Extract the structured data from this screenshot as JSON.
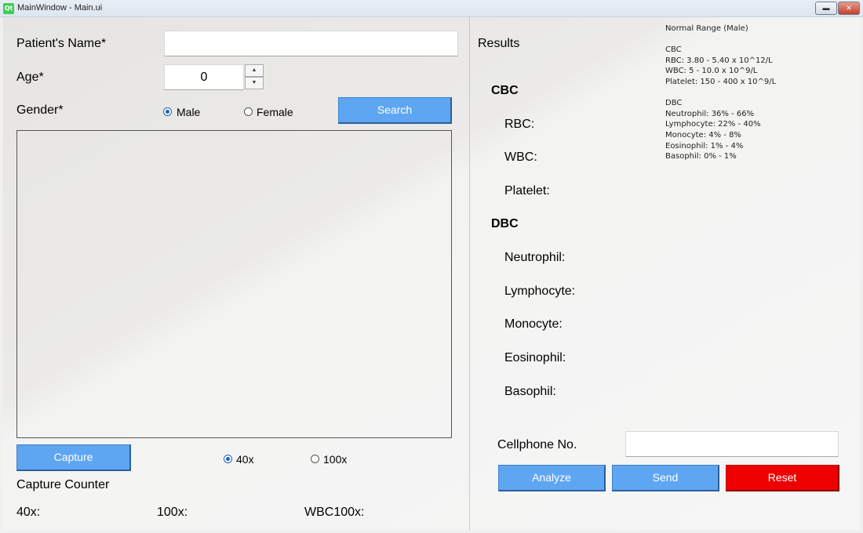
{
  "window": {
    "title": "MainWindow - Main.ui",
    "logo": "Qt"
  },
  "form": {
    "name_label": "Patient's Name*",
    "name_value": "",
    "age_label": "Age*",
    "age_value": "0",
    "gender_label": "Gender*",
    "gender_options": [
      "Male",
      "Female"
    ],
    "gender_selected": "Male",
    "search_button": "Search"
  },
  "capture": {
    "button": "Capture",
    "magnifications": [
      "40x",
      "100x"
    ],
    "selected": "40x",
    "counter_label": "Capture Counter",
    "counters": [
      "40x:",
      "100x:",
      "WBC100x:"
    ]
  },
  "results": {
    "title": "Results",
    "cbc_heading": "CBC",
    "cbc_items": [
      "RBC:",
      "WBC:",
      "Platelet:"
    ],
    "dbc_heading": "DBC",
    "dbc_items": [
      "Neutrophil:",
      "Lymphocyte:",
      "Monocyte:",
      "Eosinophil:",
      "Basophil:"
    ],
    "cellphone_label": "Cellphone No.",
    "cellphone_value": "",
    "buttons": {
      "analyze": "Analyze",
      "send": "Send",
      "reset": "Reset"
    }
  },
  "normal_range": {
    "title": "Normal Range (Male)",
    "cbc_heading": "CBC",
    "cbc_lines": [
      "RBC: 3.80 - 5.40 x 10^12/L",
      "WBC: 5 - 10.0 x 10^9/L",
      "Platelet: 150 - 400 x 10^9/L"
    ],
    "dbc_heading": "DBC",
    "dbc_lines": [
      "Neutrophil: 36% - 66%",
      "Lymphocyte: 22% - 40%",
      "Monocyte: 4% - 8%",
      "Eosinophil: 1% - 4%",
      "Basophil: 0% - 1%"
    ]
  },
  "colors": {
    "button_blue": "#5ea6f2",
    "button_red": "#ee0000",
    "radio_checked": "#1f5fb5"
  }
}
